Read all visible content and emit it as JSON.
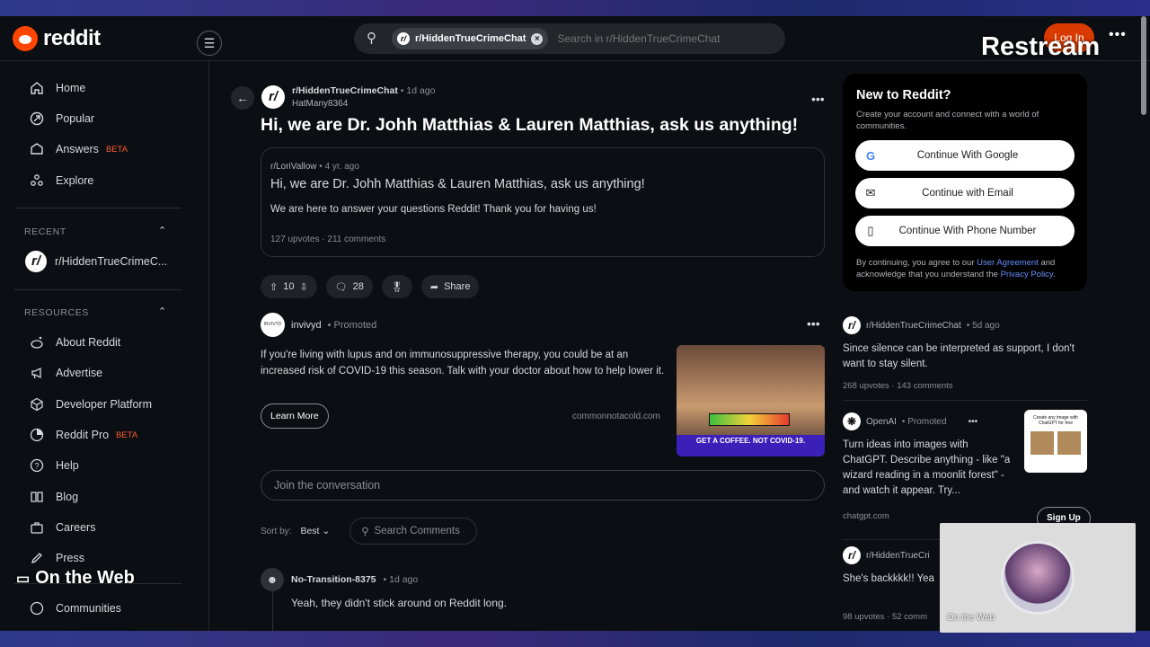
{
  "header": {
    "logo_text": "reddit",
    "search_chip": "r/HiddenTrueCrimeChat",
    "search_placeholder": "Search in r/HiddenTrueCrimeChat",
    "login_label": "Log In",
    "overlay_brand": "Restream"
  },
  "sidebar": {
    "nav": [
      {
        "label": "Home",
        "icon": "home-icon"
      },
      {
        "label": "Popular",
        "icon": "popular-icon"
      },
      {
        "label": "Answers",
        "icon": "answers-icon",
        "badge": "BETA"
      },
      {
        "label": "Explore",
        "icon": "explore-icon"
      }
    ],
    "recent_header": "RECENT",
    "recent_item": "r/HiddenTrueCrimeC...",
    "resources_header": "RESOURCES",
    "resources": [
      {
        "label": "About Reddit",
        "icon": "reddit-icon"
      },
      {
        "label": "Advertise",
        "icon": "megaphone-icon"
      },
      {
        "label": "Developer Platform",
        "icon": "cube-icon"
      },
      {
        "label": "Reddit Pro",
        "icon": "pro-icon",
        "badge": "BETA"
      },
      {
        "label": "Help",
        "icon": "help-icon"
      },
      {
        "label": "Blog",
        "icon": "book-icon"
      },
      {
        "label": "Careers",
        "icon": "briefcase-icon"
      },
      {
        "label": "Press",
        "icon": "pen-icon"
      }
    ],
    "communities_label": "Communities",
    "overlay_on_the_web": "On the Web"
  },
  "post": {
    "subreddit": "r/HiddenTrueCrimeChat",
    "time": "1d ago",
    "author": "HatMany8364",
    "title": "Hi, we are Dr. Johh Matthias & Lauren Matthias, ask us anything!",
    "crosspost": {
      "subreddit": "r/LoriVallow",
      "time": "4 yr. ago",
      "title": "Hi, we are Dr. Johh Matthias & Lauren Matthias, ask us anything!",
      "body": "We are here to answer your questions Reddit! Thank you for having us!",
      "upvotes": "127 upvotes",
      "comments": "211 comments"
    },
    "votes": "10",
    "comment_count": "28",
    "share_label": "Share"
  },
  "ad": {
    "advertiser": "invivyd",
    "promoted": "Promoted",
    "logo_text": "INVIVYD",
    "text": "If you're living with lupus and on immunosuppressive therapy, you could be at an increased risk of COVID-19 this season. Talk with your doctor about how to help lower it.",
    "cta": "Learn More",
    "domain": "commonnotacold.com",
    "image_band": "GET A COFFEE. NOT COVID-19."
  },
  "comments_area": {
    "join_placeholder": "Join the conversation",
    "sort_label": "Sort by:",
    "sort_value": "Best",
    "search_label": "Search Comments",
    "first_comment": {
      "author": "No-Transition-8375",
      "time": "1d ago",
      "text": "Yeah, they didn't stick around on Reddit long."
    }
  },
  "right": {
    "new_title": "New to Reddit?",
    "new_sub": "Create your account and connect with a world of communities.",
    "buttons": [
      "Continue With Google",
      "Continue with Email",
      "Continue With Phone Number"
    ],
    "legal_pre": "By continuing, you agree to our ",
    "legal_link1": "User Agreement",
    "legal_mid": " and acknowledge that you understand the ",
    "legal_link2": "Privacy Policy",
    "legal_end": ".",
    "related": [
      {
        "subreddit": "r/HiddenTrueCrimeChat",
        "time": "5d ago",
        "title": "Since silence can be interpreted as support, I don't want to stay silent.",
        "upvotes": "268 upvotes",
        "comments": "143 comments"
      }
    ],
    "openai_ad": {
      "advertiser": "OpenAI",
      "promoted": "Promoted",
      "text": "Turn ideas into images with ChatGPT. Describe anything - like \"a wizard reading in a moonlit forest\" - and watch it appear. Try...",
      "domain": "chatgpt.com",
      "cta": "Sign Up",
      "thumb_text": "Create any image with ChatGPT for free"
    },
    "related2": {
      "subreddit": "r/HiddenTrueCri",
      "title": "She's backkkk!! Yea",
      "upvotes": "98 upvotes",
      "comments": "52 comm"
    }
  },
  "webcam": {
    "label": "On the Web"
  }
}
